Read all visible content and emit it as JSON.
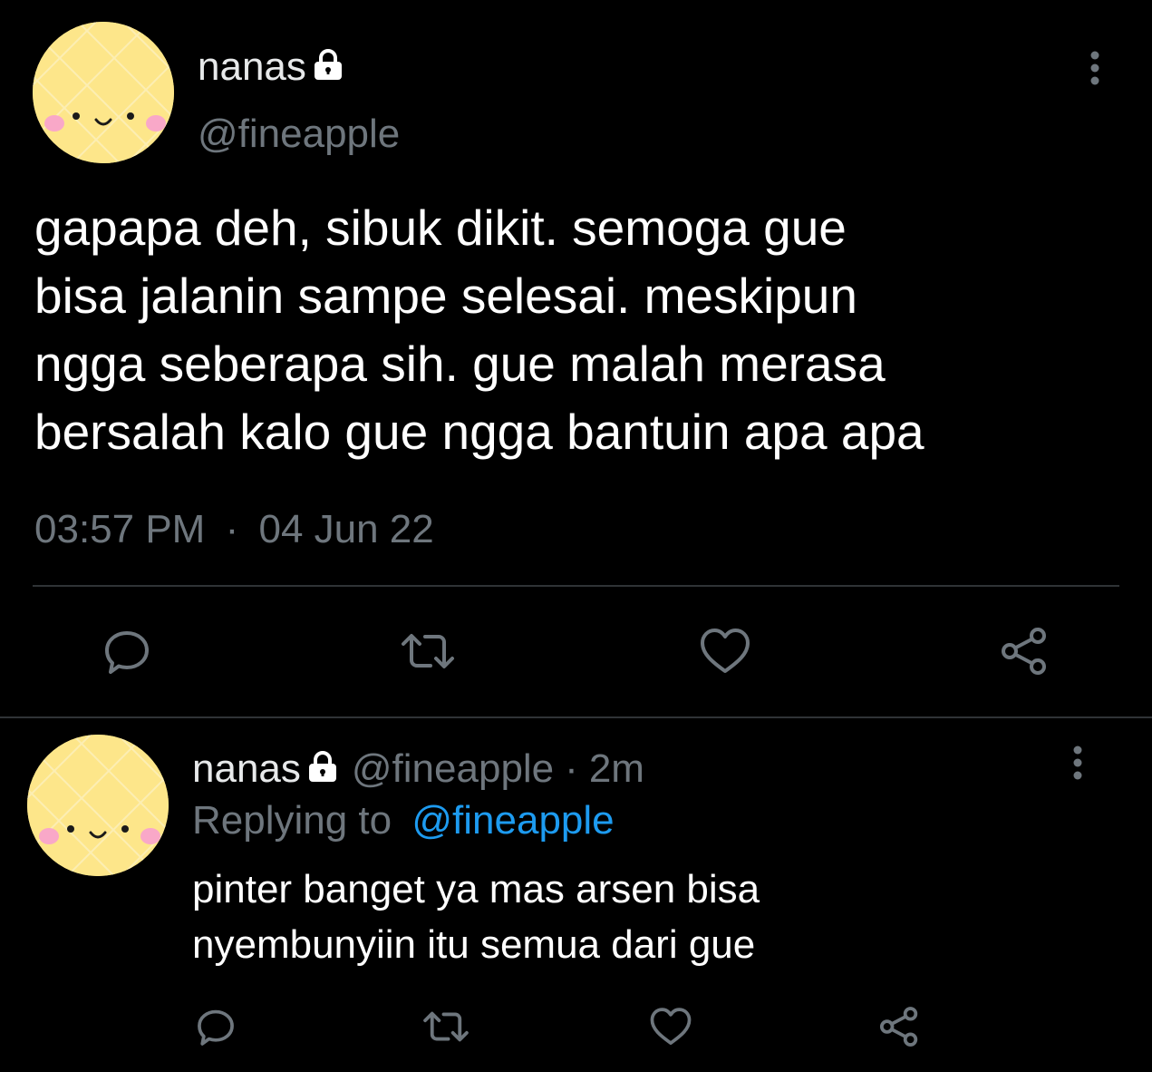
{
  "main_tweet": {
    "display_name": "nanas",
    "handle": "@fineapple",
    "text_lines": [
      "gapapa deh, sibuk dikit. semoga gue",
      "bisa jalanin sampe selesai. meskipun",
      "ngga seberapa sih. gue malah merasa",
      "bersalah kalo gue ngga bantuin apa apa"
    ],
    "time": "03:57 PM",
    "separator": "·",
    "date": "04 Jun 22"
  },
  "reply_tweet": {
    "display_name": "nanas",
    "handle": "@fineapple",
    "separator": "·",
    "age": "2m",
    "replying_prefix": "Replying to",
    "replying_handle": "@fineapple",
    "text_lines": [
      "pinter banget ya mas arsen bisa",
      "nyembunyiin itu semua dari gue"
    ]
  },
  "icons": {
    "lock": "lock-icon",
    "more": "more-vertical-icon",
    "reply": "reply-icon",
    "retweet": "retweet-icon",
    "like": "heart-icon",
    "share": "share-icon"
  },
  "colors": {
    "background": "#000000",
    "text": "#ffffff",
    "muted": "#6e767d",
    "link": "#1d9bf0",
    "divider": "#2f3336",
    "avatar": "#fde68a",
    "cheek": "#f9a8c8"
  }
}
